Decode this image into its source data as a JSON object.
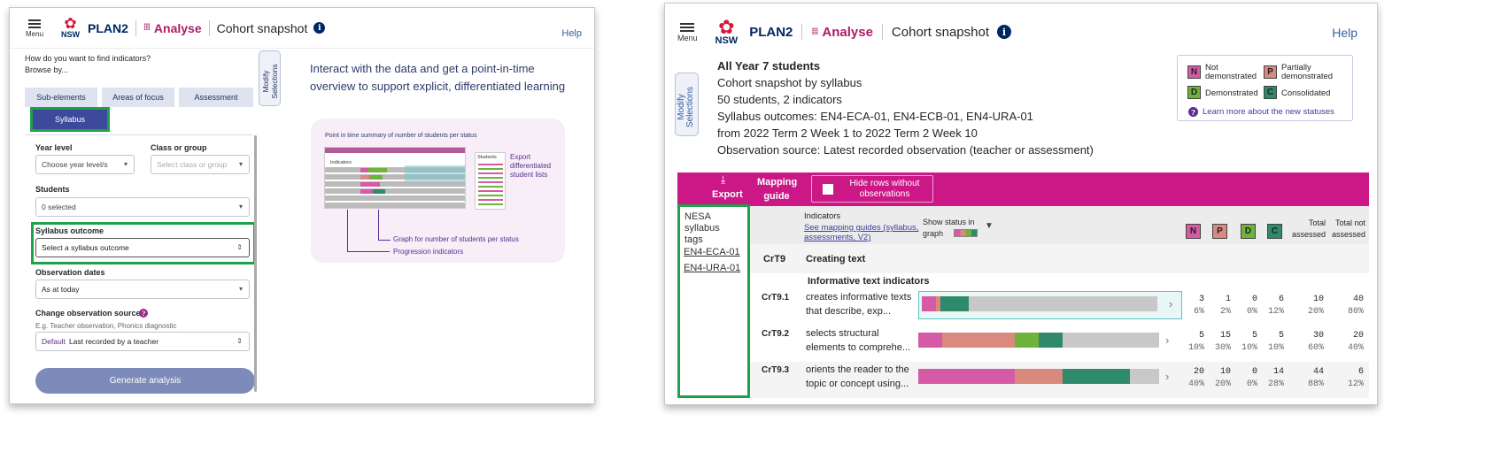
{
  "header": {
    "menu_label": "Menu",
    "nsw_label": "NSW",
    "app_name": "PLAN2",
    "analyse_label": "Analyse",
    "page_title": "Cohort snapshot",
    "help_label": "Help",
    "info_glyph": "i"
  },
  "modify_tab": {
    "line1": "Modify",
    "line2": "Selections"
  },
  "left_panel": {
    "question": "How do you want to find indicators?",
    "browse_by": "Browse by...",
    "tabs": [
      "Sub-elements",
      "Areas of focus",
      "Assessment",
      "Syllabus"
    ],
    "year_level": {
      "label": "Year level",
      "placeholder": "Choose year level/s"
    },
    "class_group": {
      "label": "Class or group",
      "placeholder": "Select class or group"
    },
    "students": {
      "label": "Students",
      "value": "0 selected"
    },
    "syllabus_outcome": {
      "label": "Syllabus outcome",
      "value": "Select a syllabus outcome"
    },
    "observation_dates": {
      "label": "Observation dates",
      "value": "As at today"
    },
    "obs_source": {
      "label": "Change observation source",
      "help_glyph": "?",
      "hint": "E.g. Teacher observation, Phonics diagnostic",
      "default_tag": "Default",
      "value": "Last recorded by a teacher"
    },
    "generate_button": "Generate analysis",
    "intro_text": "Interact with the data and get a point-in-time overview to support explicit, differentiated learning",
    "illustration": {
      "title": "Point in time summary of number of students per status",
      "indicators_label": "Indicators",
      "students_label": "Students",
      "export_note": "Export differentiated student lists",
      "graph_note": "Graph for number of students per status",
      "progression_note": "Progression indicators"
    }
  },
  "right_panel": {
    "summary": [
      "All Year 7 students",
      "Cohort snapshot by syllabus",
      "50 students, 2 indicators",
      "Syllabus outcomes: EN4-ECA-01, EN4-ECB-01, EN4-URA-01",
      "from 2022 Term 2 Week 1 to 2022 Term 2 Week 10",
      "Observation source: Latest recorded observation (teacher or assessment)"
    ],
    "legend": [
      {
        "letter": "N",
        "label": "Not demonstrated",
        "color": "#d65ba6"
      },
      {
        "letter": "P",
        "label": "Partially demonstrated",
        "color": "#d9897d"
      },
      {
        "letter": "D",
        "label": "Demonstrated",
        "color": "#6fb33a"
      },
      {
        "letter": "C",
        "label": "Consolidated",
        "color": "#2f8a6c"
      }
    ],
    "learn_more": "Learn more about the new statuses",
    "toolbar": {
      "export": "Export",
      "mapping_guide": "Mapping guide",
      "hide_rows": "Hide rows without observations"
    },
    "tags_panel": {
      "title": "NESA syllabus tags",
      "links": [
        "EN4-ECA-01",
        "EN4-URA-01"
      ]
    },
    "table_header": {
      "indicators": "Indicators",
      "mapping_link": "See mapping guides (syllabus, assessments, V2)",
      "show_status": "Show status in graph",
      "total_assessed": "Total assessed",
      "total_not_assessed": "Total not assessed"
    },
    "group": {
      "code": "CrT9",
      "title": "Creating text",
      "subgroup": "Informative text indicators"
    },
    "rows": [
      {
        "code": "CrT9.1",
        "text": "creates informative texts that describe, exp...",
        "counts": [
          "3",
          "1",
          "0",
          "6"
        ],
        "pcts": [
          "6%",
          "2%",
          "0%",
          "12%"
        ],
        "assessed": "10",
        "assessed_pct": "20%",
        "not_assessed": "40",
        "not_assessed_pct": "80%"
      },
      {
        "code": "CrT9.2",
        "text": "selects structural elements to comprehe...",
        "counts": [
          "5",
          "15",
          "5",
          "5"
        ],
        "pcts": [
          "10%",
          "30%",
          "10%",
          "10%"
        ],
        "assessed": "30",
        "assessed_pct": "60%",
        "not_assessed": "20",
        "not_assessed_pct": "40%"
      },
      {
        "code": "CrT9.3",
        "text": "orients the reader to the topic or concept using...",
        "counts": [
          "20",
          "10",
          "0",
          "14"
        ],
        "pcts": [
          "40%",
          "20%",
          "0%",
          "28%"
        ],
        "assessed": "44",
        "assessed_pct": "88%",
        "not_assessed": "6",
        "not_assessed_pct": "12%"
      }
    ]
  }
}
